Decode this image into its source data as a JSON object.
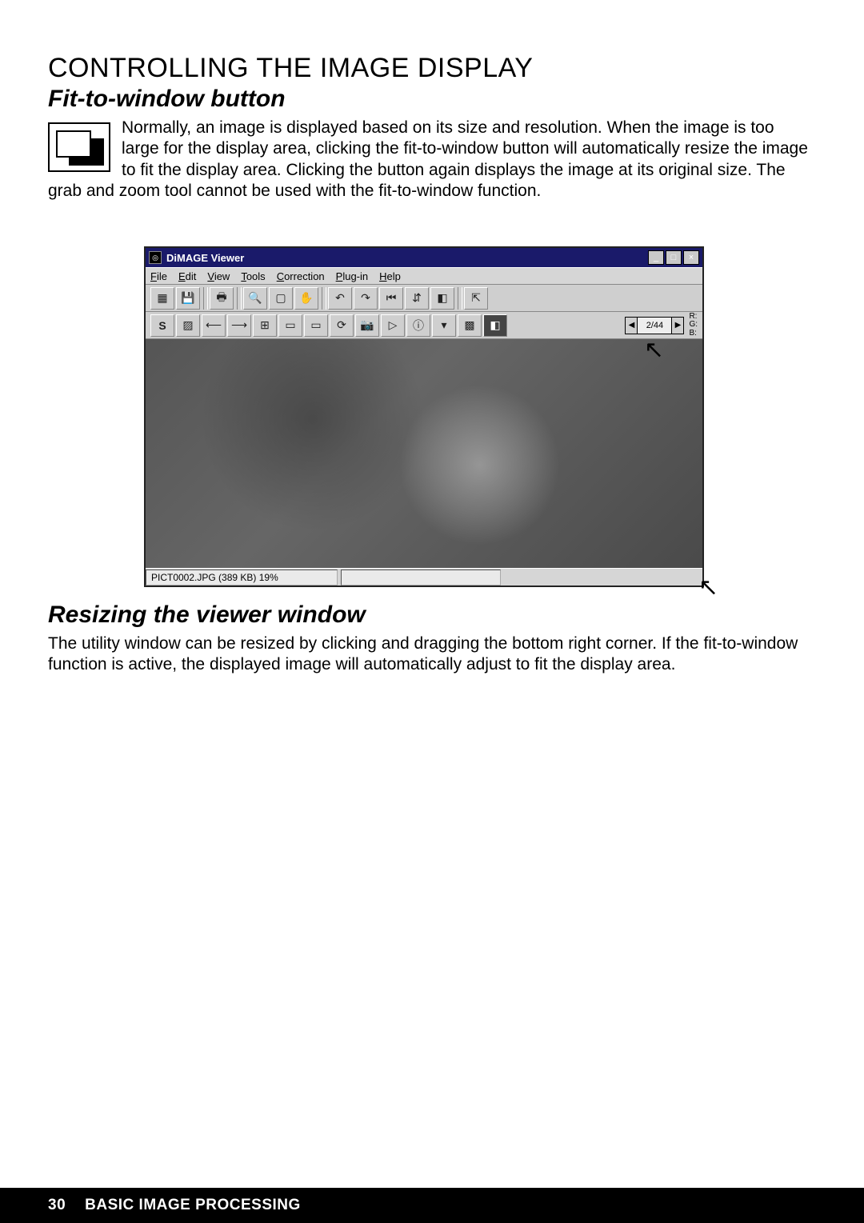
{
  "section_title": "CONTROLLING THE IMAGE DISPLAY",
  "fit": {
    "heading": "Fit-to-window button",
    "body": "Normally, an image is displayed based on its size and resolution. When the image is too large for the display area, clicking the fit-to-window button will automatically resize the image to fit the display area. Clicking the button again displays the image at its original size. The grab and zoom tool cannot be used with the fit-to-window function."
  },
  "window": {
    "title": "DiMAGE Viewer",
    "menus": {
      "file": "File",
      "edit": "Edit",
      "view": "View",
      "tools": "Tools",
      "correction": "Correction",
      "plugin": "Plug-in",
      "help": "Help"
    },
    "nav": {
      "count": "2/44"
    },
    "rgb": {
      "r": "R:",
      "g": "G:",
      "b": "B:"
    },
    "status": "PICT0002.JPG (389 KB) 19%",
    "controls": {
      "min": "_",
      "max": "□",
      "close": "×"
    }
  },
  "resize": {
    "heading": "Resizing the viewer window",
    "body": "The utility window can be resized by clicking and dragging the bottom right corner. If the fit-to-window function is active, the displayed image will automatically adjust to fit the display area."
  },
  "footer": {
    "page": "30",
    "chapter": "BASIC IMAGE PROCESSING"
  }
}
